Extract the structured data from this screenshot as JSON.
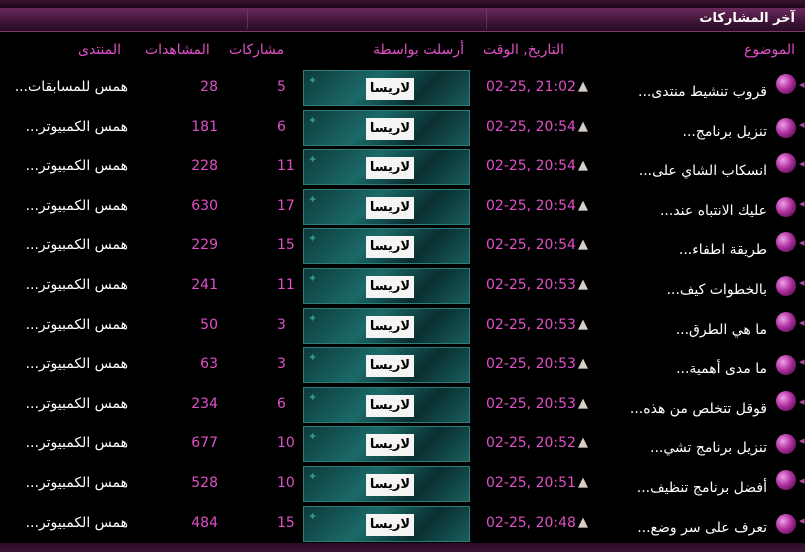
{
  "header": {
    "title": "آخر المشاركات"
  },
  "columns": {
    "topic": "الموضوع",
    "date": "التاريخ, الوقت",
    "sender": "أرسلت بواسطة",
    "posts": "مشاركات",
    "views": "المشاهدات",
    "forum": "المنتدى"
  },
  "rows": [
    {
      "topic": "قروب تنشيط منتدى...",
      "date": "02-25, 21:02",
      "sender": "لاريسا",
      "posts": "5",
      "views": "28",
      "forum": "همس للمسابقات..."
    },
    {
      "topic": "تنزيل برنامج...",
      "date": "02-25, 20:54",
      "sender": "لاريسا",
      "posts": "6",
      "views": "181",
      "forum": "همس الكمبيوتر..."
    },
    {
      "topic": "انسكاب الشاي على...",
      "date": "02-25, 20:54",
      "sender": "لاريسا",
      "posts": "11",
      "views": "228",
      "forum": "همس الكمبيوتر..."
    },
    {
      "topic": "عليك الانتباه عند...",
      "date": "02-25, 20:54",
      "sender": "لاريسا",
      "posts": "17",
      "views": "630",
      "forum": "همس الكمبيوتر..."
    },
    {
      "topic": "طريقة اطفاء...",
      "date": "02-25, 20:54",
      "sender": "لاريسا",
      "posts": "15",
      "views": "229",
      "forum": "همس الكمبيوتر..."
    },
    {
      "topic": "بالخطوات كيف...",
      "date": "02-25, 20:53",
      "sender": "لاريسا",
      "posts": "11",
      "views": "241",
      "forum": "همس الكمبيوتر..."
    },
    {
      "topic": "ما هي الطرق...",
      "date": "02-25, 20:53",
      "sender": "لاريسا",
      "posts": "3",
      "views": "50",
      "forum": "همس الكمبيوتر..."
    },
    {
      "topic": "ما مدى أهمية...",
      "date": "02-25, 20:53",
      "sender": "لاريسا",
      "posts": "3",
      "views": "63",
      "forum": "همس الكمبيوتر..."
    },
    {
      "topic": "قوقل تتخلص من هذه...",
      "date": "02-25, 20:53",
      "sender": "لاريسا",
      "posts": "6",
      "views": "234",
      "forum": "همس الكمبيوتر..."
    },
    {
      "topic": "تنزيل برنامج تشي...",
      "date": "02-25, 20:52",
      "sender": "لاريسا",
      "posts": "10",
      "views": "677",
      "forum": "همس الكمبيوتر..."
    },
    {
      "topic": "أفضل برنامج تنظيف...",
      "date": "02-25, 20:51",
      "sender": "لاريسا",
      "posts": "10",
      "views": "528",
      "forum": "همس الكمبيوتر..."
    },
    {
      "topic": "تعرف على سر وضع...",
      "date": "02-25, 20:48",
      "sender": "لاريسا",
      "posts": "15",
      "views": "484",
      "forum": "همس الكمبيوتر..."
    }
  ],
  "colors": {
    "accent": "#e050c8",
    "header": "#3d1436"
  },
  "icons": {
    "bullet": "purple-orb-icon",
    "arrow": "triangle-up-icon"
  }
}
